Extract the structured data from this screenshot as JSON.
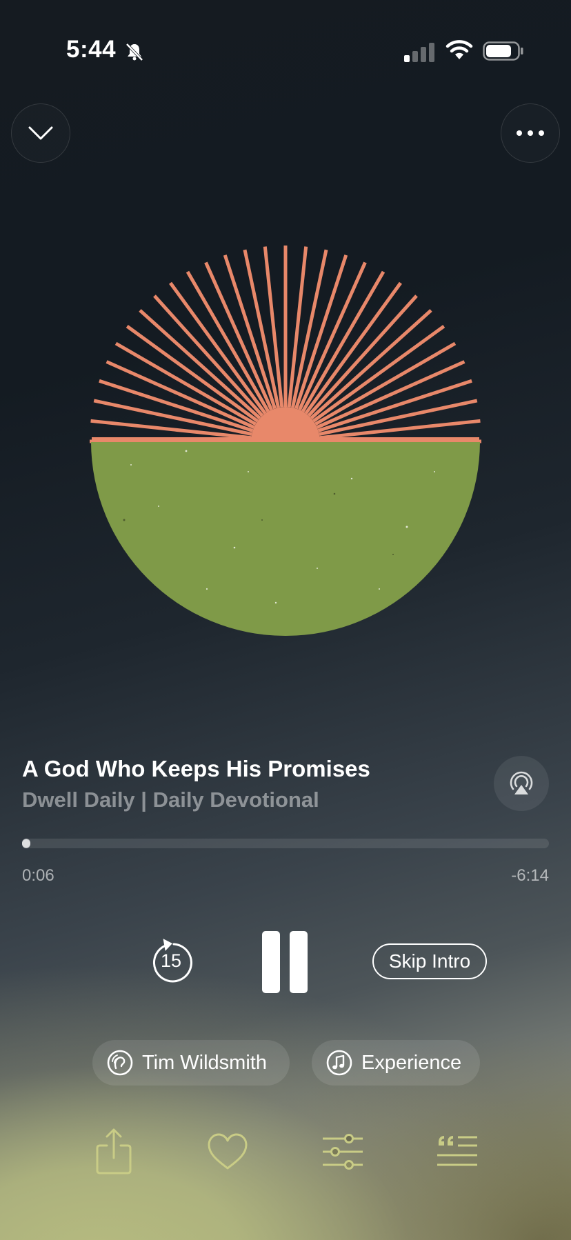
{
  "status_bar": {
    "time": "5:44",
    "icons": [
      "bell-slash-icon",
      "cellular-signal-icon",
      "wifi-icon",
      "battery-icon"
    ]
  },
  "header": {
    "collapse_icon": "chevron-down-icon",
    "more_icon": "ellipsis-icon"
  },
  "now_playing": {
    "title": "A God Who Keeps His Promises",
    "subtitle": "Dwell Daily | Daily Devotional",
    "airplay_icon": "airplay-icon"
  },
  "progress": {
    "elapsed": "0:06",
    "remaining": "-6:14",
    "fraction": 0.016
  },
  "transport": {
    "skip_back_seconds": "15",
    "skip_back_icon": "rewind-15-icon",
    "pause_icon": "pause-icon",
    "skip_intro_label": "Skip Intro"
  },
  "pills": {
    "narrator_label": "Tim Wildsmith",
    "narrator_icon": "voice-icon",
    "experience_label": "Experience",
    "experience_icon": "music-note-icon"
  },
  "toolbar": {
    "icons": [
      "share-icon",
      "heart-icon",
      "sliders-icon",
      "quote-list-icon"
    ]
  },
  "colors": {
    "sun": "#e8886a",
    "field": "#7f9a48",
    "toolbar_icon": "#c9cc86"
  }
}
